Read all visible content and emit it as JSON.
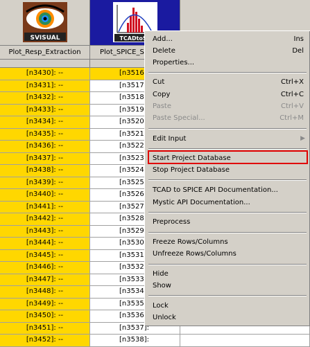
{
  "columns": [
    {
      "name": "Plot_Resp_Extraction",
      "tool": "SVisual"
    },
    {
      "name": "Plot_SPICE_S",
      "tool": "TCADtoSPICE"
    }
  ],
  "logos": {
    "svisual_text": "SVISUAL",
    "tcadtospice_text": "TCADtoSP"
  },
  "rows": [
    {
      "c1": "[n3430]: --",
      "c2": "[n3516]:"
    },
    {
      "c1": "[n3431]: --",
      "c2": "[n3517]:"
    },
    {
      "c1": "[n3432]: --",
      "c2": "[n3518]:"
    },
    {
      "c1": "[n3433]: --",
      "c2": "[n3519]:"
    },
    {
      "c1": "[n3434]: --",
      "c2": "[n3520]:"
    },
    {
      "c1": "[n3435]: --",
      "c2": "[n3521]:"
    },
    {
      "c1": "[n3436]: --",
      "c2": "[n3522]:"
    },
    {
      "c1": "[n3437]: --",
      "c2": "[n3523]:"
    },
    {
      "c1": "[n3438]: --",
      "c2": "[n3524]:"
    },
    {
      "c1": "[n3439]: --",
      "c2": "[n3525]:"
    },
    {
      "c1": "[n3440]: --",
      "c2": "[n3526]:"
    },
    {
      "c1": "[n3441]: --",
      "c2": "[n3527]:"
    },
    {
      "c1": "[n3442]: --",
      "c2": "[n3528]:"
    },
    {
      "c1": "[n3443]: --",
      "c2": "[n3529]:"
    },
    {
      "c1": "[n3444]: --",
      "c2": "[n3530]:"
    },
    {
      "c1": "[n3445]: --",
      "c2": "[n3531]:"
    },
    {
      "c1": "[n3446]: --",
      "c2": "[n3532]:"
    },
    {
      "c1": "[n3447]: --",
      "c2": "[n3533]:"
    },
    {
      "c1": "[n3448]: --",
      "c2": "[n3534]:"
    },
    {
      "c1": "[n3449]: --",
      "c2": "[n3535]:"
    },
    {
      "c1": "[n3450]: --",
      "c2": "[n3536]:"
    },
    {
      "c1": "[n3451]: --",
      "c2": "[n3537]:"
    },
    {
      "c1": "[n3452]: --",
      "c2": "[n3538]:"
    }
  ],
  "menu": {
    "add": {
      "label": "Add...",
      "shortcut": "Ins"
    },
    "delete": {
      "label": "Delete",
      "shortcut": "Del"
    },
    "properties": {
      "label": "Properties..."
    },
    "cut": {
      "label": "Cut",
      "shortcut": "Ctrl+X"
    },
    "copy": {
      "label": "Copy",
      "shortcut": "Ctrl+C"
    },
    "paste": {
      "label": "Paste",
      "shortcut": "Ctrl+V"
    },
    "paste_special": {
      "label": "Paste Special...",
      "shortcut": "Ctrl+M"
    },
    "edit_input": {
      "label": "Edit Input"
    },
    "start_db": {
      "label": "Start Project Database"
    },
    "stop_db": {
      "label": "Stop Project Database"
    },
    "tcad_doc": {
      "label": "TCAD to SPICE API Documentation..."
    },
    "mystic_doc": {
      "label": "Mystic API Documentation..."
    },
    "preprocess": {
      "label": "Preprocess"
    },
    "freeze": {
      "label": "Freeze Rows/Columns"
    },
    "unfreeze": {
      "label": "Unfreeze Rows/Columns"
    },
    "hide": {
      "label": "Hide"
    },
    "show": {
      "label": "Show"
    },
    "lock": {
      "label": "Lock"
    },
    "unlock": {
      "label": "Unlock"
    }
  },
  "colors": {
    "yellow": "#ffd700",
    "selected": "#1a1aa0",
    "highlight": "#e00000"
  }
}
